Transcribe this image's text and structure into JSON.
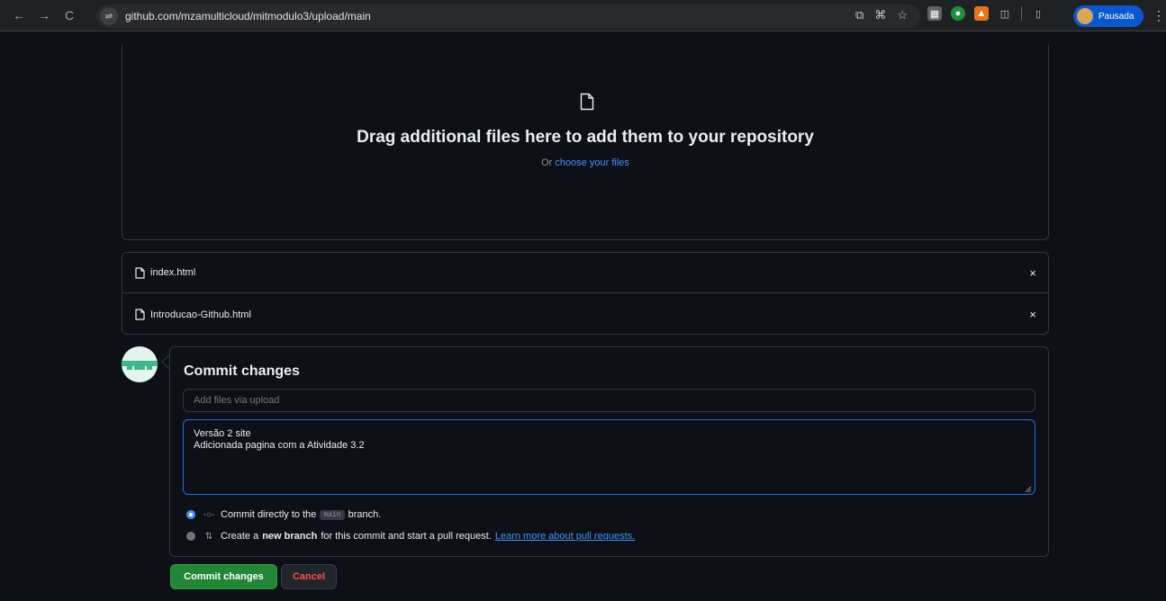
{
  "browser": {
    "url": "github.com/mzamulticloud/mitmodulo3/upload/main",
    "profile_label": "Pausada",
    "back_icon": "←",
    "forward_icon": "→",
    "reload_icon": "C",
    "menu_icon": "⋮"
  },
  "dropzone": {
    "title": "Drag additional files here to add them to your repository",
    "or_text": "Or",
    "choose_link": "choose your files"
  },
  "files": [
    {
      "name": "index.html",
      "remove": "×"
    },
    {
      "name": "Introducao-Github.html",
      "remove": "×"
    }
  ],
  "commit": {
    "title": "Commit changes",
    "summary_placeholder": "Add files via upload",
    "summary_value": "",
    "description": "Versão 2 site\nAdicionada pagina com a Atividade 3.2",
    "option_direct_pre": "Commit directly to the",
    "option_direct_branch": "main",
    "option_direct_post": "branch.",
    "option_new_pre": "Create a",
    "option_new_bold": "new branch",
    "option_new_post": "for this commit and start a pull request.",
    "option_new_link": "Learn more about pull requests.",
    "commit_button": "Commit changes",
    "cancel_button": "Cancel"
  },
  "colors": {
    "background": "#0d1117",
    "accent_blue": "#4493f8",
    "commit_green": "#238636",
    "cancel_red": "#f85149"
  }
}
